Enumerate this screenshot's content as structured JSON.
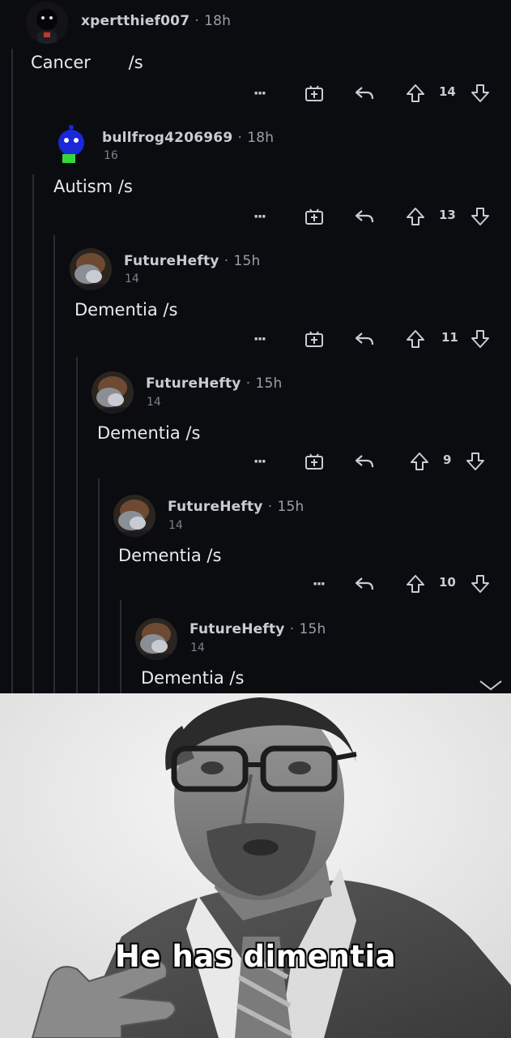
{
  "comments": [
    {
      "username": "xpertthief007",
      "time": "18h",
      "karma": "",
      "body": "Cancer       /s",
      "score": "14",
      "has_award": true
    },
    {
      "username": "bullfrog4206969",
      "time": "18h",
      "karma": "16",
      "body": "Autism /s",
      "score": "13",
      "has_award": true
    },
    {
      "username": "FutureHefty",
      "time": "15h",
      "karma": "14",
      "body": "Dementia /s",
      "score": "11",
      "has_award": true
    },
    {
      "username": "FutureHefty",
      "time": "15h",
      "karma": "14",
      "body": "Dementia /s",
      "score": "9",
      "has_award": true
    },
    {
      "username": "FutureHefty",
      "time": "15h",
      "karma": "14",
      "body": "Dementia /s",
      "score": "10",
      "has_award": false
    },
    {
      "username": "FutureHefty",
      "time": "15h",
      "karma": "14",
      "body": "Dementia /s",
      "score": "",
      "has_award": false
    }
  ],
  "separator": "·",
  "more_label": "···",
  "icons": {
    "more": "more-icon",
    "award": "award-icon",
    "reply": "reply-icon",
    "upvote": "upvote-arrow-icon",
    "downvote": "downvote-arrow-icon",
    "collapse": "chevron-down-icon"
  },
  "meme": {
    "caption": "He has dimentia"
  },
  "colors": {
    "background": "#0b0c10",
    "text": "#e8eaef",
    "meta": "#9a9ea8",
    "thread_line": "#2a2c33",
    "meme_bg": "#f2f2f2"
  }
}
